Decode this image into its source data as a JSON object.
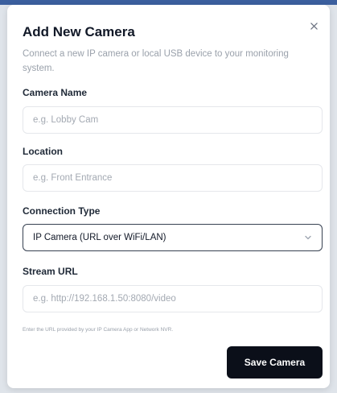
{
  "dialog": {
    "title": "Add New Camera",
    "subtitle": "Connect a new IP camera or local USB device to your monitoring system.",
    "close_icon": "close-icon"
  },
  "fields": {
    "camera_name": {
      "label": "Camera Name",
      "placeholder": "e.g. Lobby Cam",
      "value": ""
    },
    "location": {
      "label": "Location",
      "placeholder": "e.g. Front Entrance",
      "value": ""
    },
    "connection_type": {
      "label": "Connection Type",
      "selected": "IP Camera (URL over WiFi/LAN)",
      "icon": "chevron-down-icon"
    },
    "stream_url": {
      "label": "Stream URL",
      "placeholder": "e.g. http://192.168.1.50:8080/video",
      "value": "",
      "helper": "Enter the URL provided by your IP Camera App or Network NVR."
    }
  },
  "actions": {
    "save_label": "Save Camera"
  },
  "colors": {
    "primary_button": "#0b0f19",
    "top_strip": "#3b5f9e",
    "placeholder": "#a3a9b2"
  }
}
